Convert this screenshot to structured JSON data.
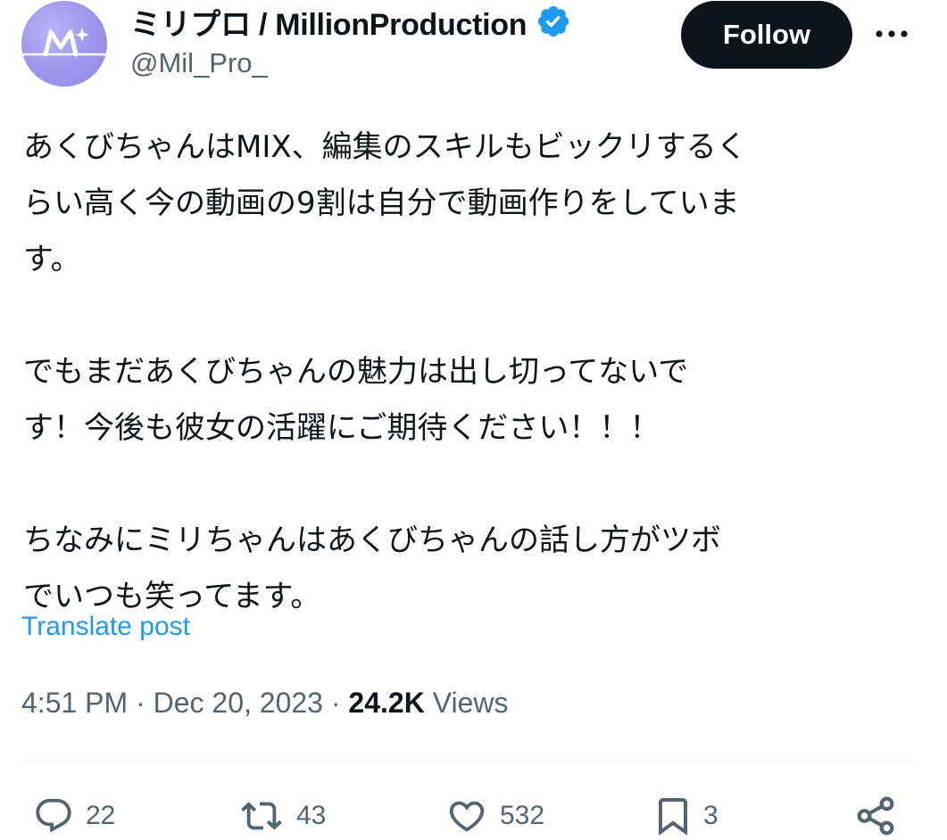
{
  "header": {
    "display_name": "ミリプロ / MillionProduction",
    "handle": "@Mil_Pro_",
    "verified": true,
    "follow_label": "Follow",
    "more_label": "•••",
    "avatar_logo": "M-logo",
    "colors": {
      "verified": "#1d9bf0",
      "follow_bg": "#0f1419",
      "avatar_bg": "#a398ee"
    }
  },
  "post": {
    "lines": [
      "あくびちゃんはMIX、編集のスキルもビックリするく",
      "らい高く今の動画の9割は自分で動画作りをしていま",
      "す。",
      "",
      "でもまだあくびちゃんの魅力は出し切ってないで",
      "す！今後も彼女の活躍にご期待ください！！！",
      "",
      "ちなみにミリちゃんはあくびちゃんの話し方がツボ",
      "でいつも笑ってます。"
    ],
    "translate_label": "Translate post"
  },
  "meta": {
    "time": "4:51 PM",
    "separator": "·",
    "date": "Dec 20, 2023",
    "views_count": "24.2K",
    "views_label": "Views"
  },
  "actions": {
    "reply": {
      "icon": "reply-icon",
      "count": "22"
    },
    "repost": {
      "icon": "repost-icon",
      "count": "43"
    },
    "like": {
      "icon": "heart-icon",
      "count": "532"
    },
    "bookmark": {
      "icon": "bookmark-icon",
      "count": "3"
    },
    "share": {
      "icon": "share-icon"
    }
  },
  "colors": {
    "text_primary": "#0f1419",
    "text_secondary": "#536471",
    "link": "#1d9bf0",
    "divider": "#eff3f4"
  }
}
